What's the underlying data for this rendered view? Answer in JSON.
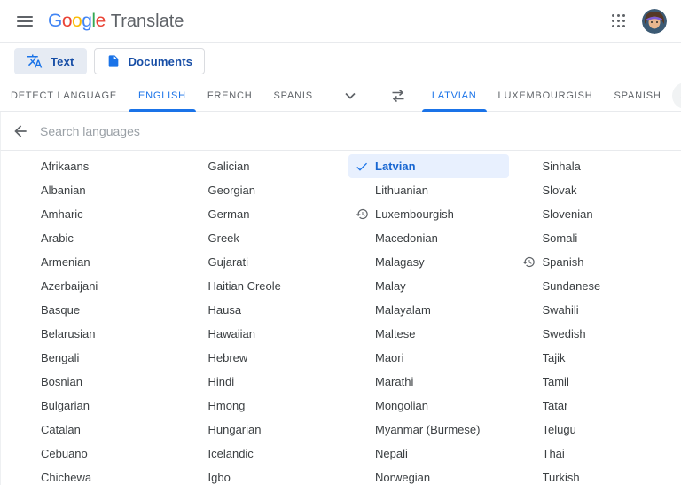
{
  "header": {
    "product_name": "Translate",
    "logo_letters": [
      {
        "ch": "G",
        "color": "#4285F4"
      },
      {
        "ch": "o",
        "color": "#EA4335"
      },
      {
        "ch": "o",
        "color": "#FBBC05"
      },
      {
        "ch": "g",
        "color": "#4285F4"
      },
      {
        "ch": "l",
        "color": "#34A853"
      },
      {
        "ch": "e",
        "color": "#EA4335"
      }
    ]
  },
  "mode_switcher": {
    "text_label": "Text",
    "documents_label": "Documents"
  },
  "language_bar": {
    "source_tabs": [
      {
        "label": "DETECT LANGUAGE",
        "selected": false
      },
      {
        "label": "ENGLISH",
        "selected": true
      },
      {
        "label": "FRENCH",
        "selected": false
      },
      {
        "label": "SPANIS",
        "selected": false
      }
    ],
    "target_tabs": [
      {
        "label": "LATVIAN",
        "selected": true
      },
      {
        "label": "LUXEMBOURGISH",
        "selected": false
      },
      {
        "label": "SPANISH",
        "selected": false
      }
    ]
  },
  "search": {
    "placeholder": "Search languages",
    "value": ""
  },
  "language_list": {
    "selected_language": "Latvian",
    "columns": [
      {
        "items": [
          {
            "name": "Afrikaans"
          },
          {
            "name": "Albanian"
          },
          {
            "name": "Amharic"
          },
          {
            "name": "Arabic"
          },
          {
            "name": "Armenian"
          },
          {
            "name": "Azerbaijani"
          },
          {
            "name": "Basque"
          },
          {
            "name": "Belarusian"
          },
          {
            "name": "Bengali"
          },
          {
            "name": "Bosnian"
          },
          {
            "name": "Bulgarian"
          },
          {
            "name": "Catalan"
          },
          {
            "name": "Cebuano"
          },
          {
            "name": "Chichewa"
          }
        ]
      },
      {
        "items": [
          {
            "name": "Galician"
          },
          {
            "name": "Georgian"
          },
          {
            "name": "German"
          },
          {
            "name": "Greek"
          },
          {
            "name": "Gujarati"
          },
          {
            "name": "Haitian Creole"
          },
          {
            "name": "Hausa"
          },
          {
            "name": "Hawaiian"
          },
          {
            "name": "Hebrew"
          },
          {
            "name": "Hindi"
          },
          {
            "name": "Hmong"
          },
          {
            "name": "Hungarian"
          },
          {
            "name": "Icelandic"
          },
          {
            "name": "Igbo"
          }
        ]
      },
      {
        "items": [
          {
            "name": "Latvian",
            "selected": true,
            "icon": "check"
          },
          {
            "name": "Lithuanian"
          },
          {
            "name": "Luxembourgish",
            "icon": "history"
          },
          {
            "name": "Macedonian"
          },
          {
            "name": "Malagasy"
          },
          {
            "name": "Malay"
          },
          {
            "name": "Malayalam"
          },
          {
            "name": "Maltese"
          },
          {
            "name": "Maori"
          },
          {
            "name": "Marathi"
          },
          {
            "name": "Mongolian"
          },
          {
            "name": "Myanmar (Burmese)"
          },
          {
            "name": "Nepali"
          },
          {
            "name": "Norwegian"
          }
        ]
      },
      {
        "items": [
          {
            "name": "Sinhala"
          },
          {
            "name": "Slovak"
          },
          {
            "name": "Slovenian"
          },
          {
            "name": "Somali"
          },
          {
            "name": "Spanish",
            "icon": "history"
          },
          {
            "name": "Sundanese"
          },
          {
            "name": "Swahili"
          },
          {
            "name": "Swedish"
          },
          {
            "name": "Tajik"
          },
          {
            "name": "Tamil"
          },
          {
            "name": "Tatar"
          },
          {
            "name": "Telugu"
          },
          {
            "name": "Thai"
          },
          {
            "name": "Turkish"
          }
        ]
      }
    ]
  },
  "icons": {
    "menu": "hamburger-icon",
    "text_mode": "translate-icon",
    "documents_mode": "document-icon",
    "more_languages": "chevron-down-icon",
    "swap": "swap-horizontal-icon",
    "collapse": "chevron-up-icon",
    "back": "arrow-left-icon",
    "selected_language": "check-icon",
    "recent_language": "history-icon",
    "apps": "apps-grid-icon"
  },
  "colors": {
    "accent_blue": "#1a73e8",
    "selected_bg": "#e8f0fe",
    "selected_text": "#1967d2",
    "tab_inactive": "#5f6368",
    "text_primary": "#3c4043",
    "border_light": "#e8eaed",
    "placeholder_text": "#9aa0a6",
    "chip_selected_bg": "#e6ebf3",
    "chip_border": "#dadce0",
    "collapse_btn_bg": "#f1f3f4"
  }
}
